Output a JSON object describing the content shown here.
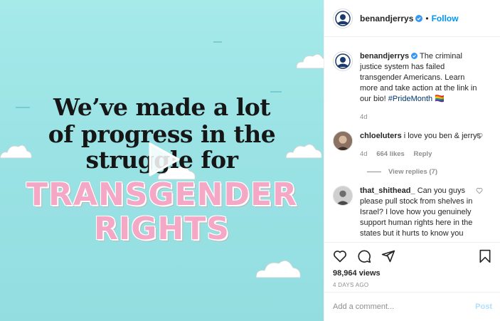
{
  "media": {
    "line1": "We’ve made a lot",
    "line2": "of progress in the",
    "line3": "struggle for",
    "pink1": "TRANSGENDER",
    "pink2": "RIGHTS"
  },
  "header": {
    "username": "benandjerrys",
    "separator": "•",
    "follow_label": "Follow"
  },
  "caption": {
    "username": "benandjerrys",
    "text": "The criminal justice system has failed transgender Americans. Learn more and take action at the link in our bio!",
    "hashtag": "#PrideMonth",
    "flag": "🏳️‍🌈",
    "age": "4d"
  },
  "comments": [
    {
      "username": "chloeluters",
      "text": "i love you ben & jerrys",
      "age": "4d",
      "likes": "664 likes",
      "reply": "Reply",
      "view_replies": "View replies (7)"
    },
    {
      "username": "that_shithead_",
      "text": "Can you guys please pull stock from shelves in Israel? I love how you genuinely support human rights here in the states but it hurts to know you"
    }
  ],
  "stats": {
    "views": "98,964 views",
    "date": "4 DAYS AGO"
  },
  "comment_box": {
    "placeholder": "Add a comment...",
    "post_label": "Post"
  },
  "colors": {
    "accent": "#0095f6",
    "media_bg": "#9be3e5",
    "pink_text": "#f4a8c6"
  }
}
